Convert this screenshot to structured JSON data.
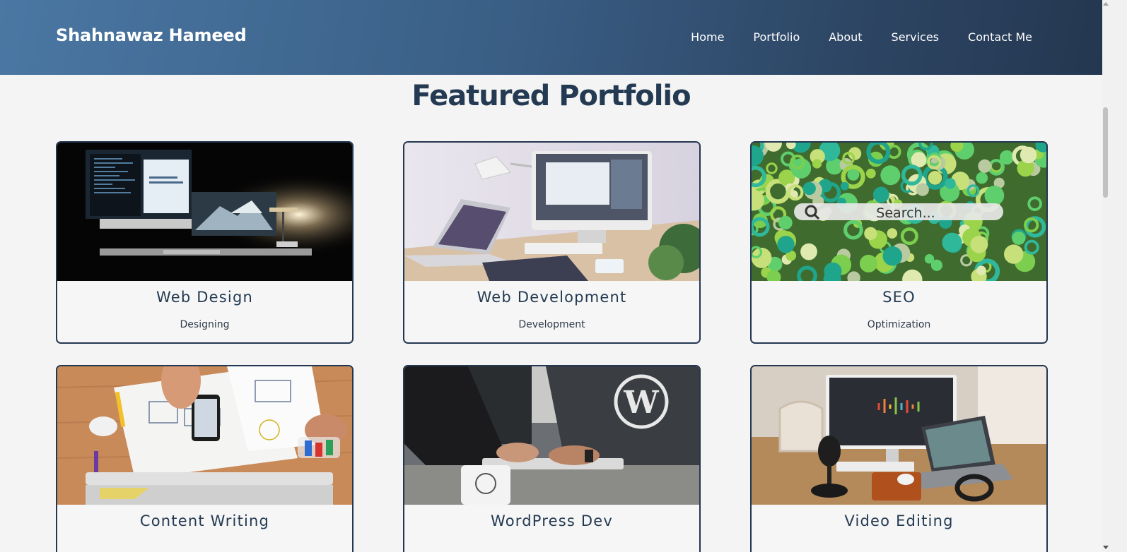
{
  "header": {
    "brand": "Shahnawaz Hameed",
    "nav": [
      "Home",
      "Portfolio",
      "About",
      "Services",
      "Contact Me"
    ]
  },
  "portfolio": {
    "title": "Featured Portfolio",
    "cards": [
      {
        "title": "Web Design",
        "subtitle": "Designing",
        "image": "dark-desk-monitors-photo"
      },
      {
        "title": "Web Development",
        "subtitle": "Development",
        "image": "bright-desk-imac-laptop-photo"
      },
      {
        "title": "SEO",
        "subtitle": "Optimization",
        "image": "green-beads-search-bar-photo",
        "image_text": "Search..."
      },
      {
        "title": "Content Writing",
        "subtitle": "",
        "image": "sketching-wireframes-desk-photo"
      },
      {
        "title": "WordPress Dev",
        "subtitle": "",
        "image": "wordpress-shirt-typing-photo"
      },
      {
        "title": "Video Editing",
        "subtitle": "",
        "image": "audio-video-workstation-photo"
      }
    ]
  },
  "colors": {
    "header_gradient_start": "#4a77a3",
    "header_gradient_end": "#243750",
    "heading": "#243a52",
    "card_border": "#243750",
    "page_background": "#f4f4f4"
  }
}
